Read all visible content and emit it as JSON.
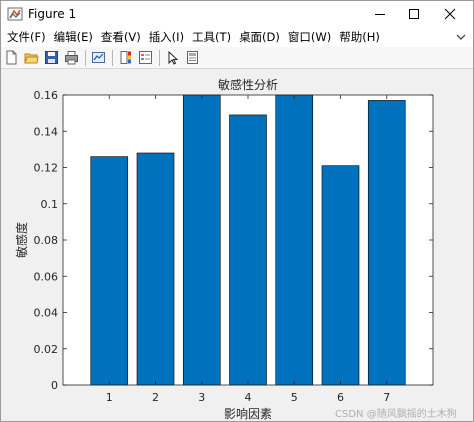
{
  "window": {
    "title": "Figure 1",
    "app_icon": "matlab-figure-icon"
  },
  "menu": {
    "items": [
      {
        "label": "文件(F)"
      },
      {
        "label": "编辑(E)"
      },
      {
        "label": "查看(V)"
      },
      {
        "label": "插入(I)"
      },
      {
        "label": "工具(T)"
      },
      {
        "label": "桌面(D)"
      },
      {
        "label": "窗口(W)"
      },
      {
        "label": "帮助(H)"
      }
    ]
  },
  "toolbar": {
    "buttons": [
      {
        "icon": "new-figure-icon"
      },
      {
        "icon": "open-file-icon"
      },
      {
        "icon": "save-icon"
      },
      {
        "icon": "print-icon"
      },
      {
        "icon": "link-plot-icon"
      },
      {
        "icon": "insert-colorbar-icon"
      },
      {
        "icon": "insert-legend-icon"
      },
      {
        "icon": "edit-plot-icon"
      },
      {
        "icon": "property-inspector-icon"
      }
    ]
  },
  "chart_data": {
    "type": "bar",
    "title": "敏感性分析",
    "xlabel": "影响因素",
    "ylabel": "敏感度",
    "categories": [
      "1",
      "2",
      "3",
      "4",
      "5",
      "6",
      "7"
    ],
    "values": [
      0.126,
      0.128,
      0.161,
      0.149,
      0.161,
      0.121,
      0.157
    ],
    "ylim": [
      0,
      0.16
    ],
    "yticks": [
      "0",
      "0.02",
      "0.04",
      "0.06",
      "0.08",
      "0.1",
      "0.12",
      "0.14",
      "0.16"
    ],
    "bar_color": "#0072BD",
    "grid": false,
    "legend": "none"
  },
  "watermark": "CSDN @随风飘摇的土木狗"
}
